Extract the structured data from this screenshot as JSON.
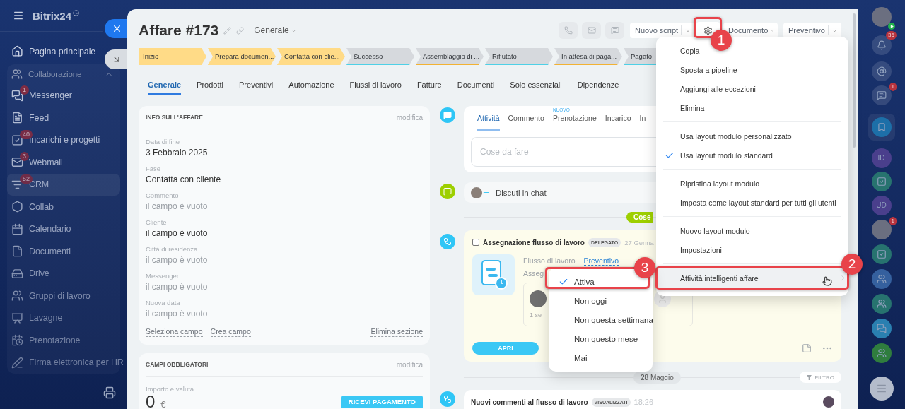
{
  "sidebar": {
    "logo": "Bitrix24",
    "home": {
      "label": "Pagina principale",
      "selected": false
    },
    "group": {
      "label": "Collaborazione",
      "expanded": true,
      "items": [
        {
          "label": "Messenger",
          "badge": "1",
          "selected": false
        },
        {
          "label": "Feed",
          "selected": false
        },
        {
          "label": "Incarichi e progetti",
          "badge": "40",
          "selected": false
        },
        {
          "label": "Webmail",
          "badge": "3",
          "selected": false
        },
        {
          "label": "CRM",
          "badge": "52",
          "selected": true
        },
        {
          "label": "Collab",
          "selected": false
        },
        {
          "label": "Calendario",
          "selected": false
        },
        {
          "label": "Documenti",
          "selected": false
        },
        {
          "label": "Drive",
          "selected": false
        },
        {
          "label": "Gruppi di lavoro",
          "selected": false
        },
        {
          "label": "Lavagne",
          "selected": false
        },
        {
          "label": "Prenotazione",
          "selected": false
        },
        {
          "label": "Firma elettronica per HR",
          "selected": false
        }
      ]
    }
  },
  "deal": {
    "title": "Affare #173",
    "category": "Generale"
  },
  "header_buttons": [
    {
      "label": "Nuovo script",
      "kind": "split"
    },
    {
      "label": "Documento",
      "kind": "dropdown"
    },
    {
      "label": "Preventivo",
      "kind": "split"
    }
  ],
  "stages": [
    {
      "label": "Inizio",
      "passed": true,
      "color": "#ffdb87"
    },
    {
      "label": "Prepara documen...",
      "passed": true,
      "color": "#ffdb87"
    },
    {
      "label": "Contatta con clie...",
      "passed": true,
      "color": "#ffdb87"
    },
    {
      "label": "Successo",
      "passed": false,
      "color": "#4fd0e6"
    },
    {
      "label": "Assemblaggio di ...",
      "passed": false,
      "color": "#f2b233"
    },
    {
      "label": "Rifiutato",
      "passed": false,
      "color": "#4fd0e6"
    },
    {
      "label": "In attesa di paga...",
      "passed": false,
      "color": "#f2b233"
    },
    {
      "label": "Pagato",
      "passed": false,
      "color": "#4fd0e6"
    }
  ],
  "tabs": [
    {
      "label": "Generale",
      "selected": true
    },
    {
      "label": "Prodotti",
      "selected": false
    },
    {
      "label": "Preventivi",
      "selected": false
    },
    {
      "label": "Automazione",
      "selected": false
    },
    {
      "label": "Flussi di lavoro",
      "selected": false
    },
    {
      "label": "Fatture",
      "selected": false
    },
    {
      "label": "Documenti",
      "selected": false
    },
    {
      "label": "Solo essenziali",
      "selected": false
    },
    {
      "label": "Dipendenze",
      "selected": false
    }
  ],
  "info_card": {
    "title": "INFO SULL'AFFARE",
    "action": "modifica",
    "fields": [
      {
        "label": "Data di fine",
        "value": "3 Febbraio 2025",
        "muted": false
      },
      {
        "label": "Fase",
        "value": "Contatta con cliente",
        "muted": false
      },
      {
        "label": "Commento",
        "value": "il campo è vuoto",
        "muted": true
      },
      {
        "label": "Cliente",
        "value": "il campo è vuoto",
        "muted": false
      },
      {
        "label": "Città di residenza",
        "value": "il campo è vuoto",
        "muted": true
      },
      {
        "label": "Messenger",
        "value": "il campo è vuoto",
        "muted": true
      },
      {
        "label": "Nuova data",
        "value": "il campo è vuoto",
        "muted": true
      }
    ],
    "links": [
      "Seleziona campo",
      "Crea campo"
    ],
    "delete_link": "Elimina sezione"
  },
  "required_card": {
    "title": "CAMPI OBBLIGATORI",
    "action": "modifica",
    "field_label": "Importo e valuta",
    "amount": "0",
    "currency": "€",
    "button": "RICEVI PAGAMENTO"
  },
  "timeline": {
    "composer": {
      "tabs": [
        {
          "label": "Attività",
          "selected": true
        },
        {
          "label": "Commento",
          "selected": false
        },
        {
          "label": "Prenotazione",
          "badge": "NUOVO",
          "selected": false
        },
        {
          "label": "Incarico",
          "selected": false
        },
        {
          "label": "In",
          "selected": false
        }
      ],
      "placeholder": "Cose da fare"
    },
    "chat": "Discuti in chat",
    "section_pill": "Cose",
    "activity": {
      "checked": false,
      "title": "Assegnazione flusso di lavoro",
      "tag": "DELEGATO",
      "date": "27 Genna",
      "flow_label": "Flusso di lavoro",
      "flow_link": "Preventivo",
      "assignee_label": "Asseg",
      "assignee_time": "1 se",
      "button": "APRI"
    },
    "date_divider": "28 Maggio",
    "filter": "FILTRO",
    "comment": {
      "title": "Nuovi commenti al flusso di lavoro",
      "tag": "VISUALIZZATI",
      "time": "18:26"
    }
  },
  "menu": {
    "groups": [
      [
        {
          "label": "Copia",
          "checked": false,
          "submenu": false,
          "highlighted": false
        },
        {
          "label": "Sposta a pipeline",
          "checked": false,
          "submenu": false,
          "highlighted": false
        },
        {
          "label": "Aggiungi alle eccezioni",
          "checked": false,
          "submenu": false,
          "highlighted": false
        },
        {
          "label": "Elimina",
          "checked": false,
          "submenu": false,
          "highlighted": false
        }
      ],
      [
        {
          "label": "Usa layout modulo personalizzato",
          "checked": false,
          "submenu": false,
          "highlighted": false
        },
        {
          "label": "Usa layout modulo standard",
          "checked": true,
          "submenu": false,
          "highlighted": false
        }
      ],
      [
        {
          "label": "Ripristina layout modulo",
          "checked": false,
          "submenu": false,
          "highlighted": false
        },
        {
          "label": "Imposta come layout standard per tutti gli utenti",
          "checked": false,
          "submenu": false,
          "highlighted": false
        }
      ],
      [
        {
          "label": "Nuovo layout modulo",
          "checked": false,
          "submenu": false,
          "highlighted": false
        },
        {
          "label": "Impostazioni",
          "checked": false,
          "submenu": false,
          "highlighted": false
        }
      ],
      [
        {
          "label": "Attività intelligenti affare",
          "checked": false,
          "submenu": true,
          "highlighted": true
        }
      ]
    ]
  },
  "submenu": {
    "items": [
      {
        "label": "Attiva",
        "checked": true
      },
      {
        "label": "Non oggi",
        "checked": false
      },
      {
        "label": "Non questa settimana",
        "checked": false
      },
      {
        "label": "Non questo mese",
        "checked": false
      },
      {
        "label": "Mai",
        "checked": false
      }
    ]
  },
  "callouts": [
    {
      "number": "1"
    },
    {
      "number": "2"
    },
    {
      "number": "3"
    }
  ],
  "rail": {
    "items": [
      {
        "kind": "avatar",
        "online": true
      },
      {
        "kind": "bell",
        "badge": "36"
      },
      {
        "kind": "spiral"
      },
      {
        "kind": "chat",
        "badge": "1"
      },
      {
        "kind": "bookmark"
      },
      {
        "kind": "initials",
        "label": "ID",
        "color": "#4a3f8c"
      },
      {
        "kind": "tasks",
        "color": "#27736f"
      },
      {
        "kind": "initials",
        "label": "UD",
        "color": "#4a3f8c"
      },
      {
        "kind": "avatar",
        "badge": "1"
      },
      {
        "kind": "tasks",
        "color": "#27736f"
      },
      {
        "kind": "people",
        "color": "#35609e"
      },
      {
        "kind": "people",
        "color": "#27736f"
      },
      {
        "kind": "messages",
        "color": "#2a7fb0"
      },
      {
        "kind": "people",
        "color": "#2f7d3e"
      },
      {
        "kind": "menu"
      }
    ]
  }
}
